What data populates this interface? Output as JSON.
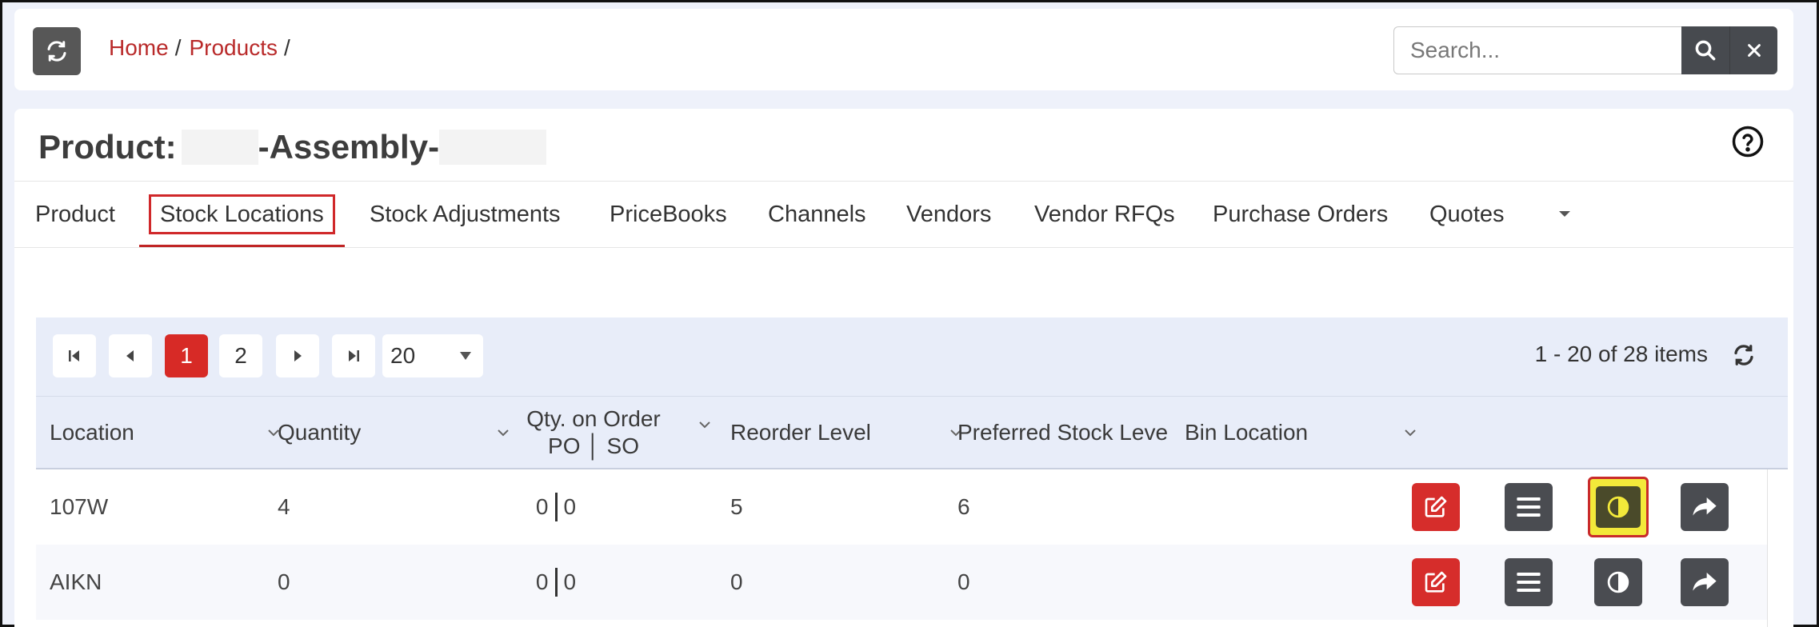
{
  "breadcrumb": {
    "home": "Home",
    "products": "Products",
    "sep": "/"
  },
  "search": {
    "placeholder": "Search...",
    "value": ""
  },
  "product": {
    "title_prefix": "Product:",
    "title_middle": "-Assembly-",
    "title_suffix_visible": ""
  },
  "tabs": [
    {
      "label": "Product"
    },
    {
      "label": "Stock Locations"
    },
    {
      "label": "Stock Adjustments"
    },
    {
      "label": "PriceBooks"
    },
    {
      "label": "Channels"
    },
    {
      "label": "Vendors"
    },
    {
      "label": "Vendor RFQs"
    },
    {
      "label": "Purchase Orders"
    },
    {
      "label": "Quotes"
    }
  ],
  "pager": {
    "pages": [
      "1",
      "2"
    ],
    "current_page": "1",
    "page_size": "20",
    "info": "1 - 20 of 28 items"
  },
  "columns": {
    "location": "Location",
    "quantity": "Quantity",
    "qty_on_order_line1": "Qty. on Order",
    "qty_on_order_line2": "PO │ SO",
    "reorder_level": "Reorder Level",
    "preferred_stock_level": "Preferred Stock Leve",
    "bin_location": "Bin Location"
  },
  "rows": [
    {
      "location": "107W",
      "quantity": "4",
      "po": "0",
      "so": "0",
      "reorder_level": "5",
      "preferred": "6",
      "bin_location": ""
    },
    {
      "location": "AIKN",
      "quantity": "0",
      "po": "0",
      "so": "0",
      "reorder_level": "0",
      "preferred": "0",
      "bin_location": ""
    }
  ],
  "colors": {
    "accent_red": "#d72a26",
    "link_red": "#b92a2a",
    "dark_button": "#4a4c51",
    "highlight_yellow": "#f3e93a"
  }
}
